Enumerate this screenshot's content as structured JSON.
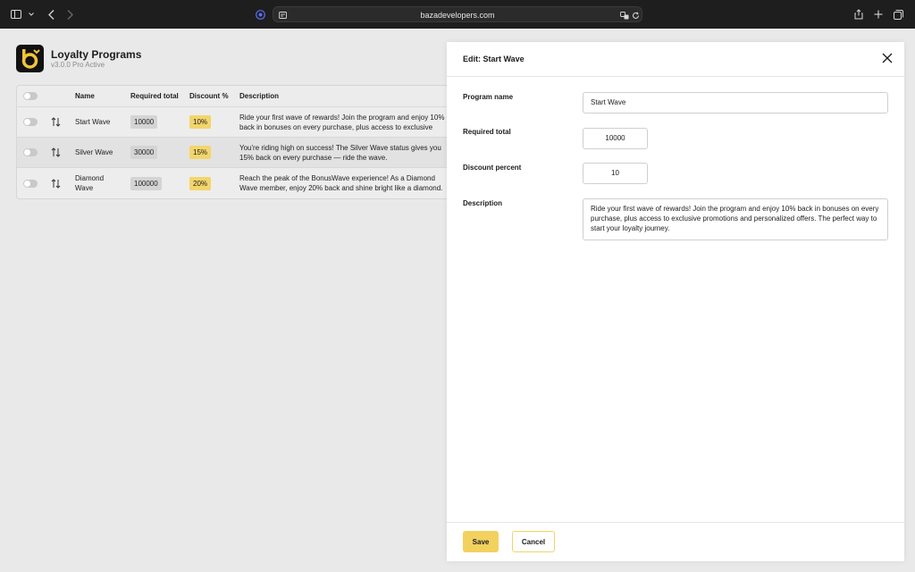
{
  "browser": {
    "url": "bazadevelopers.com"
  },
  "app": {
    "title": "Loyalty Programs",
    "subtitle": "v3.0.0 Pro Active",
    "accent_color": "#f3d15f"
  },
  "table": {
    "headers": {
      "name": "Name",
      "required_total": "Required total",
      "discount": "Discount %",
      "description": "Description"
    },
    "rows": [
      {
        "name": "Start Wave",
        "required_total": "10000",
        "discount": "10%",
        "description": "Ride your first wave of rewards! Join the program and enjoy 10% back in bonuses on every purchase, plus access to exclusive promotions and personalized offers. The perfect way to start your loyalty journey."
      },
      {
        "name": "Silver Wave",
        "required_total": "30000",
        "discount": "15%",
        "description": "You're riding high on success! The Silver Wave status gives you 15% back on every purchase — ride the wave."
      },
      {
        "name": "Diamond Wave",
        "required_total": "100000",
        "discount": "20%",
        "description": "Reach the peak of the BonusWave experience! As a Diamond Wave member, enjoy 20% back and shine bright like a diamond."
      }
    ]
  },
  "edit_panel": {
    "title": "Edit: Start Wave",
    "labels": {
      "program_name": "Program name",
      "required_total": "Required total",
      "discount_percent": "Discount percent",
      "description": "Description"
    },
    "values": {
      "program_name": "Start Wave",
      "required_total": "10000",
      "discount_percent": "10",
      "description": "Ride your first wave of rewards! Join the program and enjoy 10% back in bonuses on every purchase, plus access to exclusive promotions and personalized offers. The perfect way to start your loyalty journey."
    },
    "save_label": "Save",
    "cancel_label": "Cancel"
  }
}
